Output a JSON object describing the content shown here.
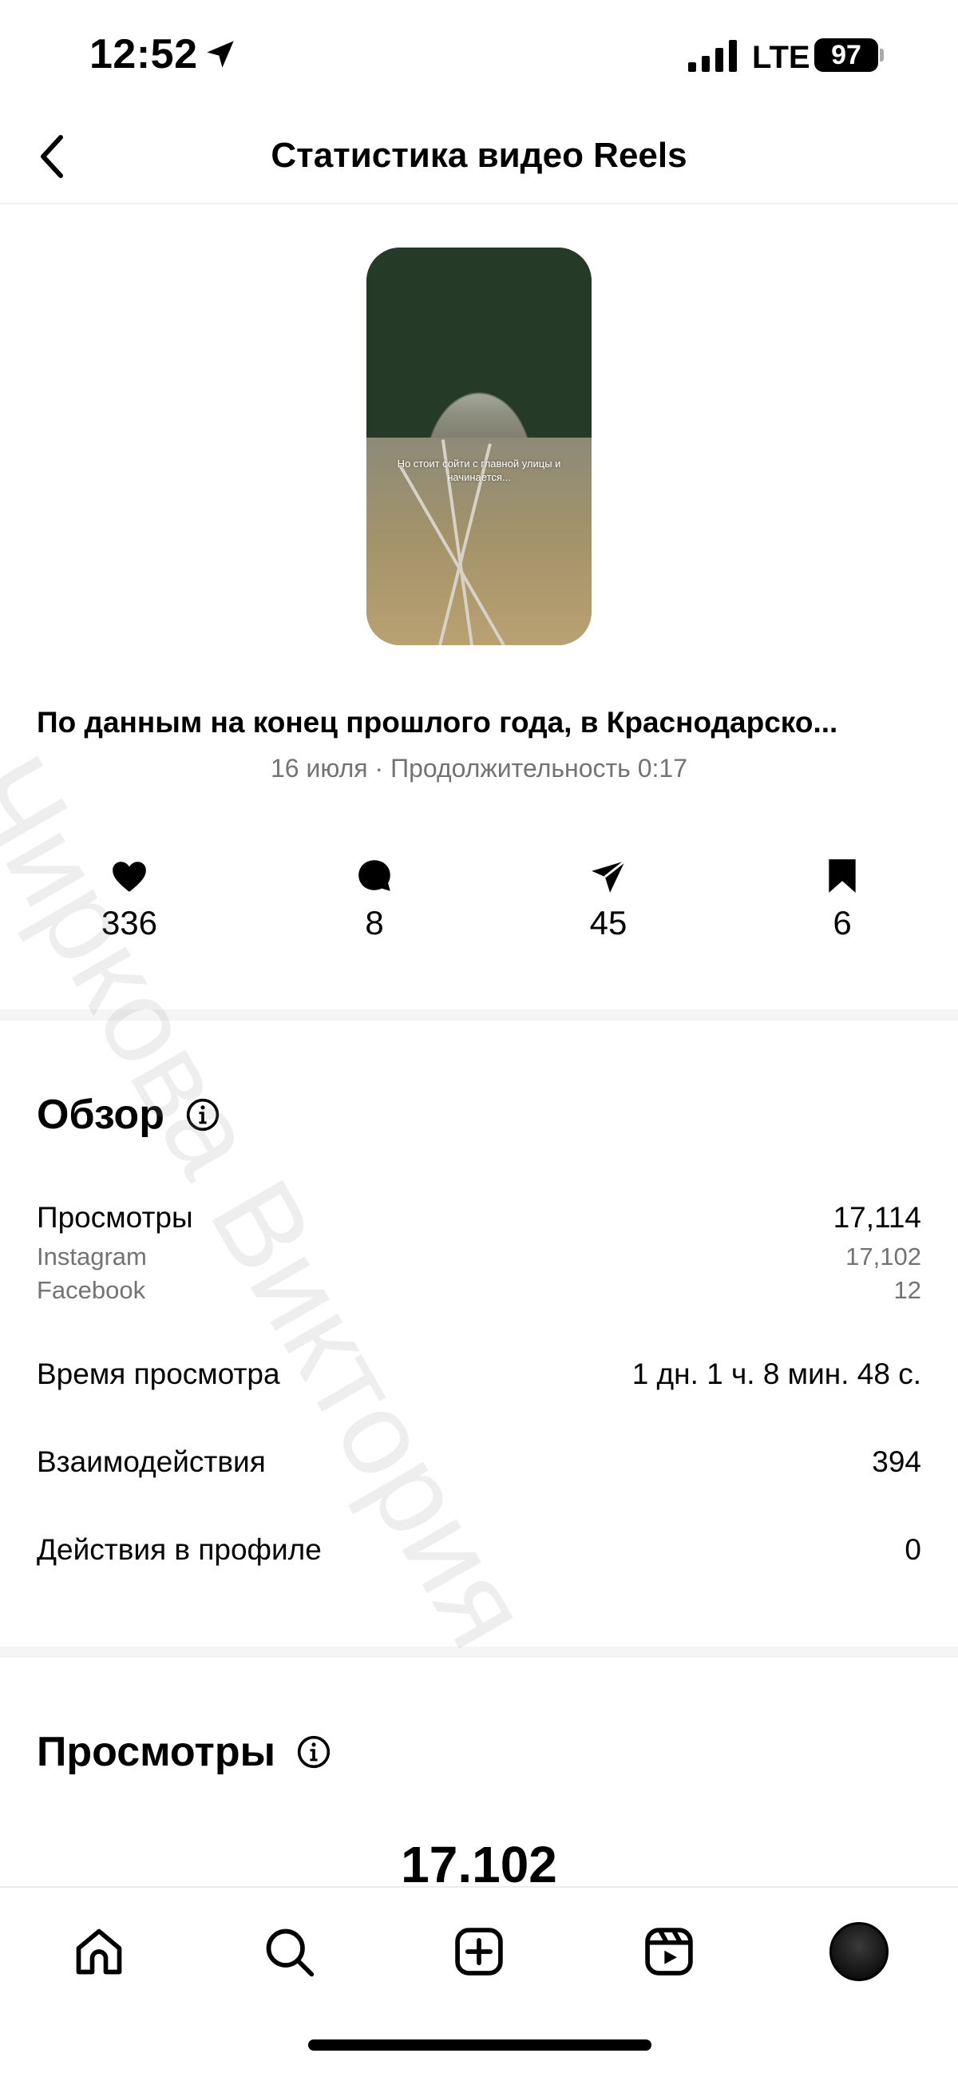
{
  "status_bar": {
    "time": "12:52",
    "network": "LTE",
    "battery": "97"
  },
  "header": {
    "title": "Статистика видео Reels"
  },
  "reel": {
    "caption": "Но стоит сойти с главной улицы и начинается...",
    "title": "По данным на конец прошлого года, в Краснодарско...",
    "meta": "16 июля · Продолжительность 0:17",
    "likes": "336",
    "comments": "8",
    "shares": "45",
    "saves": "6"
  },
  "overview": {
    "title": "Обзор",
    "views_label": "Просмотры",
    "views_value": "17,114",
    "instagram_label": "Instagram",
    "instagram_value": "17,102",
    "facebook_label": "Facebook",
    "facebook_value": "12",
    "watch_time_label": "Время просмотра",
    "watch_time_value": "1 дн. 1 ч. 8 мин. 48 с.",
    "interactions_label": "Взаимодействия",
    "interactions_value": "394",
    "profile_actions_label": "Действия в профиле",
    "profile_actions_value": "0"
  },
  "views_section": {
    "title": "Просмотры",
    "total": "17.102"
  },
  "watermark": "Чиркова Виктория",
  "icons": {
    "back": "chevron-left-icon",
    "location": "location-arrow-icon",
    "like": "heart-icon",
    "comment": "comment-icon",
    "share": "send-icon",
    "save": "bookmark-icon",
    "info": "info-icon",
    "home": "home-icon",
    "search": "search-icon",
    "create": "plus-square-icon",
    "reels": "reels-icon"
  }
}
